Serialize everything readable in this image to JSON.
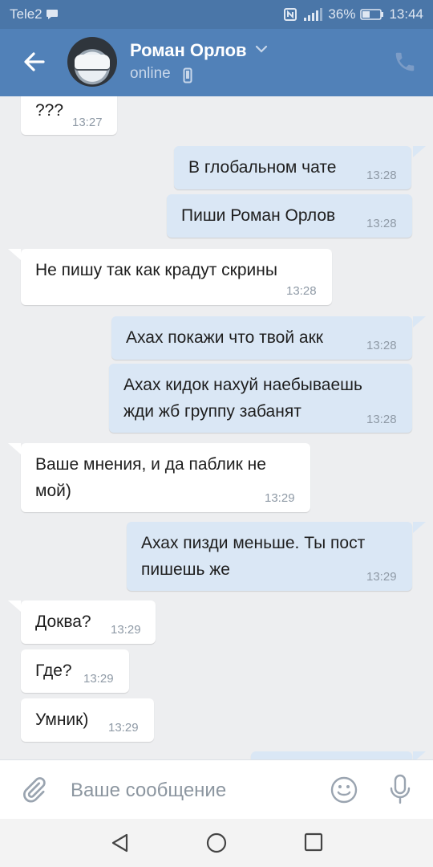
{
  "status_bar": {
    "carrier": "Tele2",
    "battery": "36%",
    "time": "13:44"
  },
  "header": {
    "name": "Роман Орлов",
    "status": "online"
  },
  "messages": [
    {
      "dir": "in",
      "lines": [
        "???"
      ],
      "time": "13:27"
    },
    {
      "dir": "out",
      "lines": [
        "В глобальном чате"
      ],
      "time": "13:28"
    },
    {
      "dir": "out",
      "lines": [
        "Пиши Роман Орлов"
      ],
      "time": "13:28"
    },
    {
      "dir": "in",
      "lines": [
        "Не пишу так как крадут скрины"
      ],
      "time": "13:28"
    },
    {
      "dir": "out",
      "lines": [
        "Ахах покажи что твой акк"
      ],
      "time": "13:28"
    },
    {
      "dir": "out",
      "lines": [
        "Ахах кидок нахуй наебываешь",
        "жди жб группу забанят"
      ],
      "time": "13:28"
    },
    {
      "dir": "in",
      "lines": [
        "Ваше мнения, и да паблик не",
        "мой)"
      ],
      "time": "13:29"
    },
    {
      "dir": "out",
      "lines": [
        "Ахах пизди меньше. Ты пост",
        "пишешь же"
      ],
      "time": "13:29"
    },
    {
      "dir": "in",
      "lines": [
        "Доква?"
      ],
      "time": "13:29"
    },
    {
      "dir": "in",
      "lines": [
        "Где?"
      ],
      "time": "13:29"
    },
    {
      "dir": "in",
      "lines": [
        "Умник)"
      ],
      "time": "13:29"
    }
  ],
  "input": {
    "placeholder": "Ваше сообщение"
  },
  "colors": {
    "header": "#5181b8",
    "status_bar": "#4a76a8",
    "incoming": "#ffffff",
    "outgoing": "#dae7f5",
    "background": "#edeef0"
  }
}
